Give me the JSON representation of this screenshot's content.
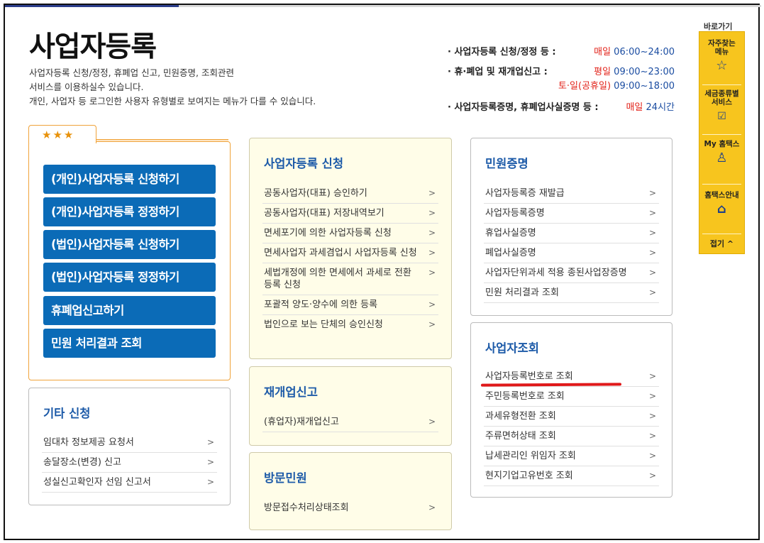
{
  "page": {
    "title": "사업자등록",
    "desc": [
      "사업자등록 신청/정정, 휴폐업 신고, 민원증명, 조회관련",
      "서비스를 이용하실수 있습니다.",
      "개인, 사업자 등 로그인한 사용자 유형별로 보여지는 메뉴가 다를 수 있습니다."
    ]
  },
  "hours": [
    {
      "label": "· 사업자등록 신청/정정 등 :",
      "day": "매일",
      "time": " 06:00~24:00"
    },
    {
      "label": "· 휴·폐업 및 재개업신고 :",
      "day": "평일",
      "time": " 09:00~23:00"
    },
    {
      "label": "",
      "day": "토·일(공휴일)",
      "time": " 09:00~18:00"
    },
    {
      "label": "· 사업자등록증명, 휴폐업사실증명 등 :",
      "day": "매일",
      "time": " 24시간"
    }
  ],
  "favorites": {
    "stars": "★★★",
    "buttons": [
      "(개인)사업자등록 신청하기",
      "(개인)사업자등록 정정하기",
      "(법인)사업자등록 신청하기",
      "(법인)사업자등록 정정하기",
      "휴폐업신고하기",
      "민원 처리결과 조회"
    ]
  },
  "etc": {
    "title": "기타 신청",
    "items": [
      "임대차 정보제공 요청서",
      "송달장소(변경) 신고",
      "성실신고확인자 선임 신고서"
    ]
  },
  "register": {
    "title": "사업자등록 신청",
    "items": [
      "공동사업자(대표) 승인하기",
      "공동사업자(대표) 저장내역보기",
      "면세포기에 의한 사업자등록 신청",
      "면세사업자 과세겸업시 사업자등록 신청",
      "세법개정에 의한 면세에서 과세로 전환 등록 신청",
      "포괄적 양도·양수에 의한 등록",
      "법인으로 보는 단체의 승인신청"
    ]
  },
  "reopen": {
    "title": "재개업신고",
    "items": [
      "(휴업자)재개업신고"
    ]
  },
  "visit": {
    "title": "방문민원",
    "items": [
      "방문접수처리상태조회"
    ]
  },
  "certificate": {
    "title": "민원증명",
    "items": [
      "사업자등록증 재발급",
      "사업자등록증명",
      "휴업사실증명",
      "폐업사실증명",
      "사업자단위과세 적용 종된사업장증명",
      "민원 처리결과 조회"
    ]
  },
  "lookup": {
    "title": "사업자조회",
    "items": [
      "사업자등록번호로 조회",
      "주민등록번호로 조회",
      "과세유형전환 조회",
      "주류면허상태 조회",
      "납세관리인 위임자 조회",
      "현지기업고유번호 조회"
    ]
  },
  "chevron": ">",
  "side": {
    "label": "바로가기",
    "items": [
      {
        "text": "자주찾는\n메뉴",
        "icon": "☆"
      },
      {
        "text": "세금종류별\n서비스",
        "icon": "☑"
      },
      {
        "text": "My 홈택스",
        "icon": "♙"
      },
      {
        "text": "홈택스안내",
        "icon": "⌂"
      }
    ],
    "close": "접기 ^"
  },
  "colors": {
    "primary_button": "#0b6bb7",
    "title_blue": "#1c5aa8",
    "accent_red": "#e2231a",
    "side_yellow": "#f7c51e",
    "fav_border": "#f0a33a"
  }
}
